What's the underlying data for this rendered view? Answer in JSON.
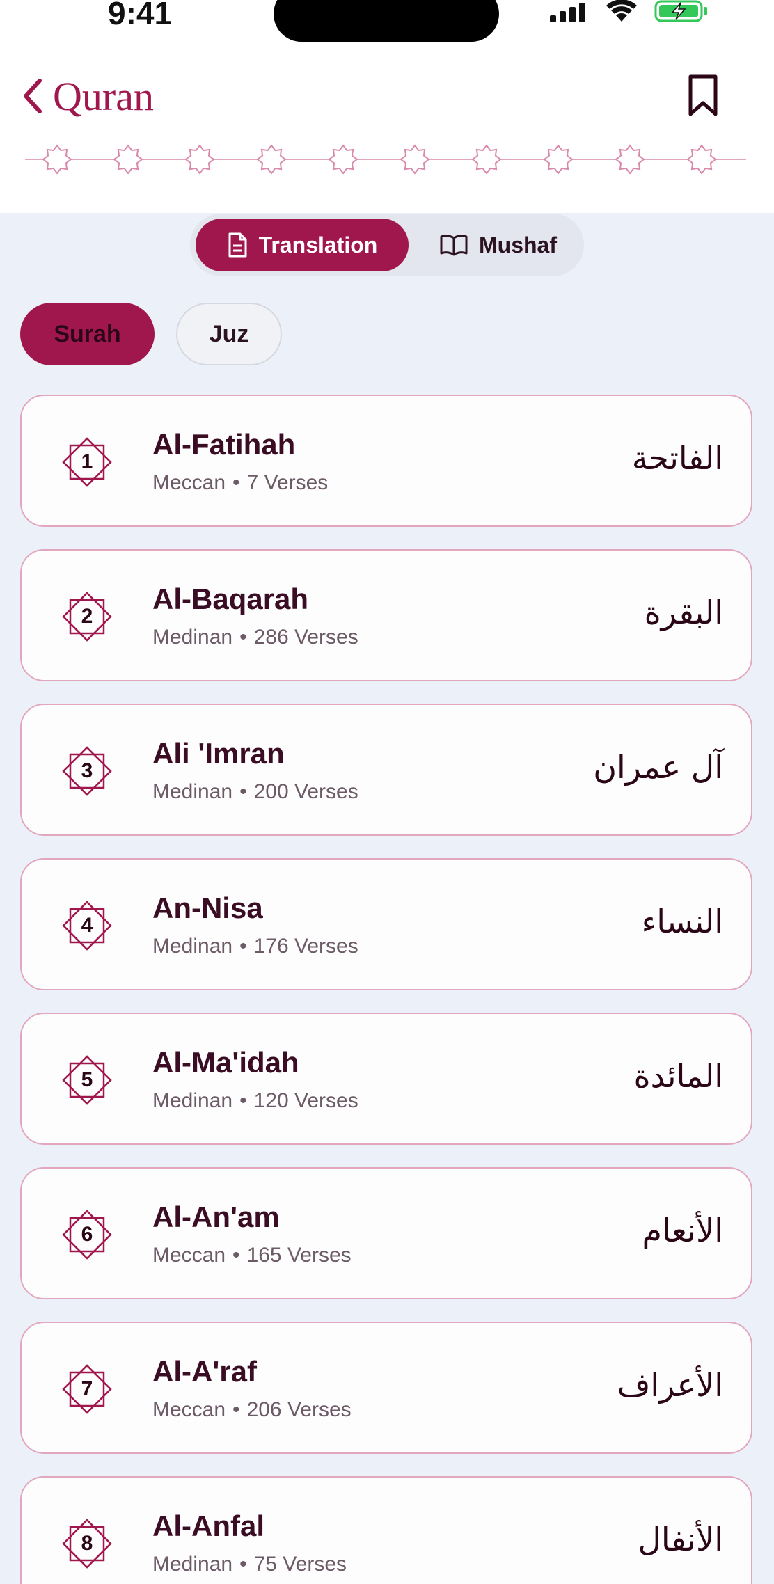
{
  "status_bar": {
    "time": "9:41"
  },
  "header": {
    "back_label": "Quran"
  },
  "view_mode": {
    "options": [
      {
        "label": "Translation",
        "icon": "document-icon",
        "selected": true
      },
      {
        "label": "Mushaf",
        "icon": "open-book-icon",
        "selected": false
      }
    ]
  },
  "filter_tabs": [
    {
      "label": "Surah",
      "selected": true
    },
    {
      "label": "Juz",
      "selected": false
    }
  ],
  "surahs": [
    {
      "number": "1",
      "name": "Al-Fatihah",
      "type": "Meccan",
      "verses": "7 Verses",
      "arabic": "الفاتحة"
    },
    {
      "number": "2",
      "name": "Al-Baqarah",
      "type": "Medinan",
      "verses": "286 Verses",
      "arabic": "البقرة"
    },
    {
      "number": "3",
      "name": "Ali 'Imran",
      "type": "Medinan",
      "verses": "200 Verses",
      "arabic": "آل عمران"
    },
    {
      "number": "4",
      "name": "An-Nisa",
      "type": "Medinan",
      "verses": "176 Verses",
      "arabic": "النساء"
    },
    {
      "number": "5",
      "name": "Al-Ma'idah",
      "type": "Medinan",
      "verses": "120 Verses",
      "arabic": "المائدة"
    },
    {
      "number": "6",
      "name": "Al-An'am",
      "type": "Meccan",
      "verses": "165 Verses",
      "arabic": "الأنعام"
    },
    {
      "number": "7",
      "name": "Al-A'raf",
      "type": "Meccan",
      "verses": "206 Verses",
      "arabic": "الأعراف"
    },
    {
      "number": "8",
      "name": "Al-Anfal",
      "type": "Medinan",
      "verses": "75 Verses",
      "arabic": "الأنفال"
    }
  ],
  "meta_separator": "•",
  "colors": {
    "accent": "#a0174e",
    "card_border": "#e2a6bf",
    "background": "#ecf0f8"
  }
}
